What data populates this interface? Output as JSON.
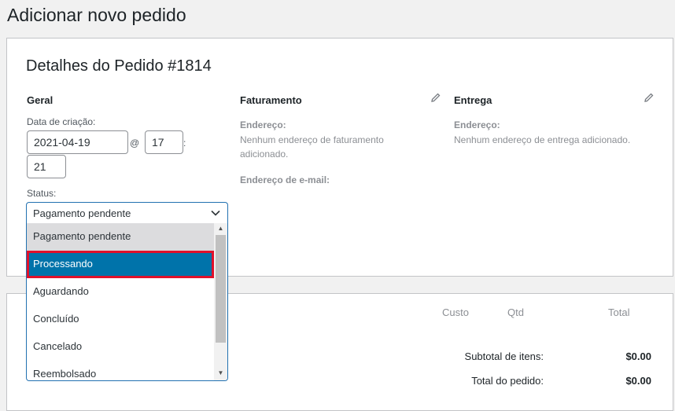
{
  "page": {
    "title": "Adicionar novo pedido"
  },
  "order": {
    "heading": "Detalhes do Pedido #1814",
    "general": {
      "title": "Geral",
      "created_label": "Data de criação:",
      "date": "2021-04-19",
      "at": "@",
      "hour": "17",
      "colon": ":",
      "minute": "21",
      "status_label": "Status:",
      "status_value": "Pagamento pendente",
      "status_options": [
        "Pagamento pendente",
        "Processando",
        "Aguardando",
        "Concluído",
        "Cancelado",
        "Reembolsado"
      ]
    },
    "billing": {
      "title": "Faturamento",
      "address_label": "Endereço:",
      "address_text": "Nenhum endereço de faturamento adicionado.",
      "email_label": "Endereço de e-mail:",
      "edit_icon": "pencil-icon"
    },
    "shipping": {
      "title": "Entrega",
      "address_label": "Endereço:",
      "address_text": "Nenhum endereço de entrega adicionado.",
      "edit_icon": "pencil-icon"
    }
  },
  "items": {
    "columns": {
      "cost": "Custo",
      "qty": "Qtd",
      "total": "Total"
    },
    "subtotal_label": "Subtotal de itens:",
    "subtotal_value": "$0.00",
    "order_total_label": "Total do pedido:",
    "order_total_value": "$0.00"
  },
  "colors": {
    "accent": "#2271b1",
    "selected_option": "#0073aa",
    "highlight_box": "#e0112b"
  }
}
